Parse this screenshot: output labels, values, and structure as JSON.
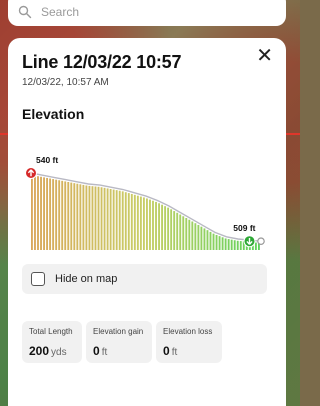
{
  "search": {
    "placeholder": "Search"
  },
  "panel": {
    "title": "Line 12/03/22 10:57",
    "subtitle": "12/03/22, 10:57 AM",
    "close_icon": "close-icon"
  },
  "elevation": {
    "heading": "Elevation",
    "start_label": "540 ft",
    "end_label": "509 ft",
    "high_marker": "up-arrow-icon",
    "low_marker": "down-arrow-icon"
  },
  "hide_on_map": {
    "label": "Hide on map",
    "checked": false
  },
  "stats": [
    {
      "label": "Total Length",
      "value": "200",
      "unit": "yds"
    },
    {
      "label": "Elevation gain",
      "value": "0",
      "unit": "ft"
    },
    {
      "label": "Elevation loss",
      "value": "0",
      "unit": "ft"
    }
  ],
  "colors": {
    "accent_red": "#e0362b",
    "high_marker": "#d62a2a",
    "low_marker": "#2ea836",
    "profile_line": "#b9b9c4",
    "bar_high": "#d9a85b",
    "bar_mid": "#c8cf67",
    "bar_low": "#5fd25c"
  },
  "chart_data": {
    "type": "area",
    "title": "Elevation",
    "xlabel": "",
    "ylabel": "",
    "y_unit": "ft",
    "ylim": [
      505,
      545
    ],
    "x": [
      0,
      10,
      20,
      30,
      40,
      50,
      60,
      70,
      80,
      90,
      100,
      110,
      120,
      130,
      140,
      150,
      160,
      170,
      180,
      190,
      200
    ],
    "values": [
      540,
      539,
      538,
      537,
      536,
      535,
      534.5,
      533.5,
      532.5,
      531,
      529.5,
      527.5,
      525,
      522,
      519,
      516,
      513,
      511,
      510,
      509.5,
      509
    ],
    "annotations": [
      {
        "label": "540 ft",
        "x": 0,
        "y": 540
      },
      {
        "label": "509 ft",
        "x": 190,
        "y": 509
      }
    ]
  }
}
